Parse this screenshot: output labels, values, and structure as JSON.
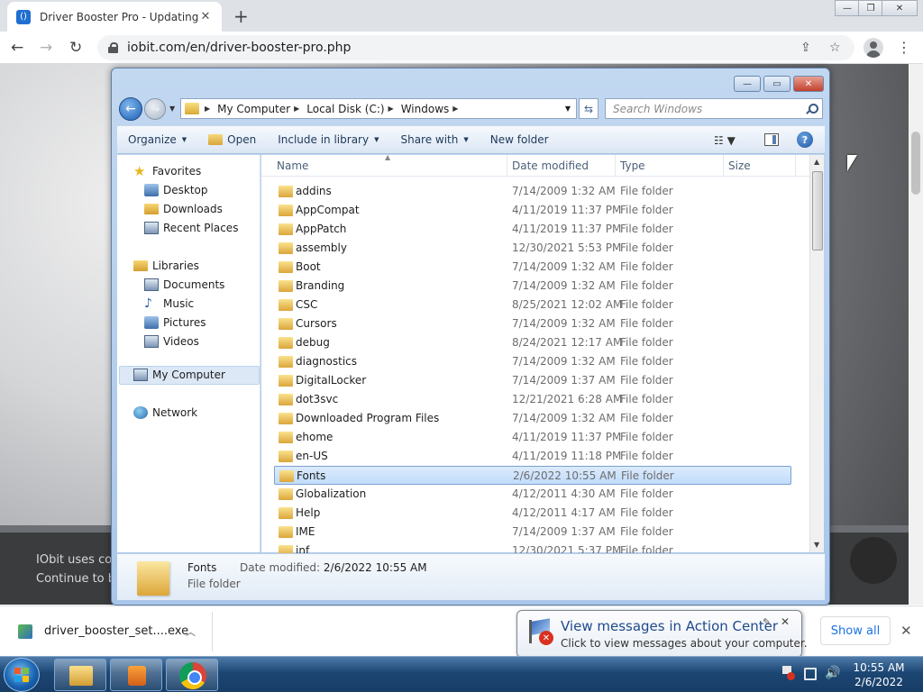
{
  "browser": {
    "tab_title": "Driver Booster Pro - Updating Ou",
    "tab_favicon": "()",
    "url": "iobit.com/en/driver-booster-pro.php",
    "icons": [
      "back-arrow-icon",
      "forward-arrow-icon",
      "reload-icon",
      "lock-icon",
      "share-icon",
      "star-icon",
      "profile-icon",
      "kebab-menu-icon"
    ]
  },
  "webpage": {
    "cookie_line1": "IObit uses co",
    "cookie_line2": "Continue to b"
  },
  "explorer": {
    "breadcrumbs": [
      "My Computer",
      "Local Disk (C:)",
      "Windows"
    ],
    "search_placeholder": "Search Windows",
    "toolbar": {
      "organize": "Organize",
      "open": "Open",
      "include_in_library": "Include in library",
      "share_with": "Share with",
      "new_folder": "New folder"
    },
    "nav": {
      "favorites": "Favorites",
      "desktop": "Desktop",
      "downloads": "Downloads",
      "recent_places": "Recent Places",
      "libraries": "Libraries",
      "documents": "Documents",
      "music": "Music",
      "pictures": "Pictures",
      "videos": "Videos",
      "my_computer": "My Computer",
      "network": "Network"
    },
    "columns": {
      "name": "Name",
      "date_modified": "Date modified",
      "type": "Type",
      "size": "Size"
    },
    "rows": [
      {
        "name": "addins",
        "date": "7/14/2009 1:32 AM",
        "type": "File folder"
      },
      {
        "name": "AppCompat",
        "date": "4/11/2019 11:37 PM",
        "type": "File folder"
      },
      {
        "name": "AppPatch",
        "date": "4/11/2019 11:37 PM",
        "type": "File folder"
      },
      {
        "name": "assembly",
        "date": "12/30/2021 5:53 PM",
        "type": "File folder"
      },
      {
        "name": "Boot",
        "date": "7/14/2009 1:32 AM",
        "type": "File folder"
      },
      {
        "name": "Branding",
        "date": "7/14/2009 1:32 AM",
        "type": "File folder"
      },
      {
        "name": "CSC",
        "date": "8/25/2021 12:02 AM",
        "type": "File folder"
      },
      {
        "name": "Cursors",
        "date": "7/14/2009 1:32 AM",
        "type": "File folder"
      },
      {
        "name": "debug",
        "date": "8/24/2021 12:17 AM",
        "type": "File folder"
      },
      {
        "name": "diagnostics",
        "date": "7/14/2009 1:32 AM",
        "type": "File folder"
      },
      {
        "name": "DigitalLocker",
        "date": "7/14/2009 1:37 AM",
        "type": "File folder"
      },
      {
        "name": "dot3svc",
        "date": "12/21/2021 6:28 AM",
        "type": "File folder"
      },
      {
        "name": "Downloaded Program Files",
        "date": "7/14/2009 1:32 AM",
        "type": "File folder"
      },
      {
        "name": "ehome",
        "date": "4/11/2019 11:37 PM",
        "type": "File folder"
      },
      {
        "name": "en-US",
        "date": "4/11/2019 11:18 PM",
        "type": "File folder"
      },
      {
        "name": "Fonts",
        "date": "2/6/2022 10:55 AM",
        "type": "File folder"
      },
      {
        "name": "Globalization",
        "date": "4/12/2011 4:30 AM",
        "type": "File folder"
      },
      {
        "name": "Help",
        "date": "4/12/2011 4:17 AM",
        "type": "File folder"
      },
      {
        "name": "IME",
        "date": "7/14/2009 1:37 AM",
        "type": "File folder"
      },
      {
        "name": "inf",
        "date": "12/30/2021 5:37 PM",
        "type": "File folder"
      }
    ],
    "selected_row": "Fonts",
    "details": {
      "name": "Fonts",
      "type": "File folder",
      "modified_label": "Date modified:",
      "modified_value": "2/6/2022 10:55 AM"
    }
  },
  "downloads": {
    "file_name": "driver_booster_set....exe",
    "show_all": "Show all"
  },
  "balloon": {
    "title": "View messages in Action Center",
    "body": "Click to view messages about your computer."
  },
  "taskbar": {
    "time": "10:55 AM",
    "date": "2/6/2022"
  },
  "colors": {
    "chrome_tab_bar": "#dee1e6",
    "explorer_frame": "#b7d0ee",
    "selection": "#c9dffa",
    "taskbar": "#1c4673",
    "link_blue": "#1a73e8"
  }
}
